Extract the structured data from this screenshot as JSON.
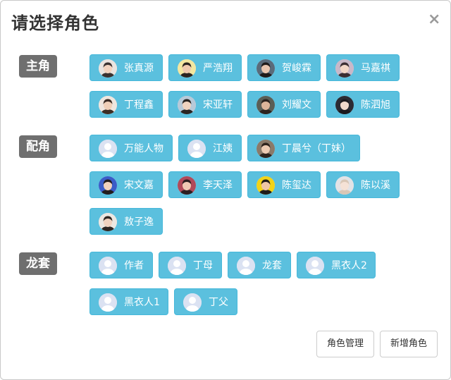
{
  "dialog": {
    "title": "请选择角色",
    "close_icon": "close-icon"
  },
  "sections": {
    "main": {
      "label": "主角",
      "roles": [
        {
          "name": "张真源",
          "avatar": "photo"
        },
        {
          "name": "严浩翔",
          "avatar": "photo"
        },
        {
          "name": "贺峻霖",
          "avatar": "photo"
        },
        {
          "name": "马嘉祺",
          "avatar": "photo"
        },
        {
          "name": "丁程鑫",
          "avatar": "photo"
        },
        {
          "name": "宋亚轩",
          "avatar": "photo"
        },
        {
          "name": "刘耀文",
          "avatar": "photo"
        },
        {
          "name": "陈泗旭",
          "avatar": "photo"
        }
      ]
    },
    "supporting": {
      "label": "配角",
      "roles": [
        {
          "name": "万能人物",
          "avatar": "default-user-icon"
        },
        {
          "name": "江姨",
          "avatar": "default-user-icon"
        },
        {
          "name": "丁晨兮（丁妹）",
          "avatar": "photo"
        },
        {
          "name": "宋文嘉",
          "avatar": "photo"
        },
        {
          "name": "李天泽",
          "avatar": "photo"
        },
        {
          "name": "陈玺达",
          "avatar": "photo"
        },
        {
          "name": "陈以溪",
          "avatar": "photo"
        },
        {
          "name": "敖子逸",
          "avatar": "photo"
        }
      ]
    },
    "extras": {
      "label": "龙套",
      "roles": [
        {
          "name": "作者",
          "avatar": "default-user-icon"
        },
        {
          "name": "丁母",
          "avatar": "default-user-icon"
        },
        {
          "name": "龙套",
          "avatar": "default-user-icon"
        },
        {
          "name": "黑衣人2",
          "avatar": "default-user-icon"
        },
        {
          "name": "黑衣人1",
          "avatar": "default-user-icon"
        },
        {
          "name": "丁父",
          "avatar": "default-user-icon"
        }
      ]
    }
  },
  "footer": {
    "manage_label": "角色管理",
    "add_label": "新增角色"
  },
  "colors": {
    "chip_bg": "#5bc0de",
    "chip_border": "#46b8da",
    "section_label_bg": "#6f6f6f"
  }
}
